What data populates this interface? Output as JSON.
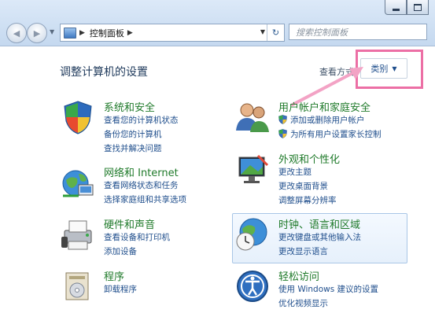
{
  "nav": {
    "back_glyph": "◀",
    "forward_glyph": "▶",
    "breadcrumb": [
      "控制面板"
    ],
    "refresh_glyph": "↻",
    "search_placeholder": "搜索控制面板"
  },
  "header": {
    "title": "调整计算机的设置",
    "view_by_label": "查看方式：",
    "view_by_value": "类别"
  },
  "categories": {
    "system": {
      "title": "系统和安全",
      "links": [
        "查看您的计算机状态",
        "备份您的计算机",
        "查找并解决问题"
      ]
    },
    "network": {
      "title": "网络和 Internet",
      "links": [
        "查看网络状态和任务",
        "选择家庭组和共享选项"
      ]
    },
    "hardware": {
      "title": "硬件和声音",
      "links": [
        "查看设备和打印机",
        "添加设备"
      ]
    },
    "programs": {
      "title": "程序",
      "links": [
        "卸载程序"
      ]
    },
    "users": {
      "title": "用户帐户和家庭安全",
      "links": [
        "添加或删除用户帐户",
        "为所有用户设置家长控制"
      ]
    },
    "appearance": {
      "title": "外观和个性化",
      "links": [
        "更改主题",
        "更改桌面背景",
        "调整屏幕分辨率"
      ]
    },
    "clock": {
      "title": "时钟、语言和区域",
      "links": [
        "更改键盘或其他输入法",
        "更改显示语言"
      ]
    },
    "ease": {
      "title": "轻松访问",
      "links": [
        "使用 Windows 建议的设置",
        "优化视频显示"
      ]
    }
  },
  "colors": {
    "annotation": "#ec6fa5",
    "category_title": "#1f7a2a",
    "link": "#1f4e8c"
  }
}
